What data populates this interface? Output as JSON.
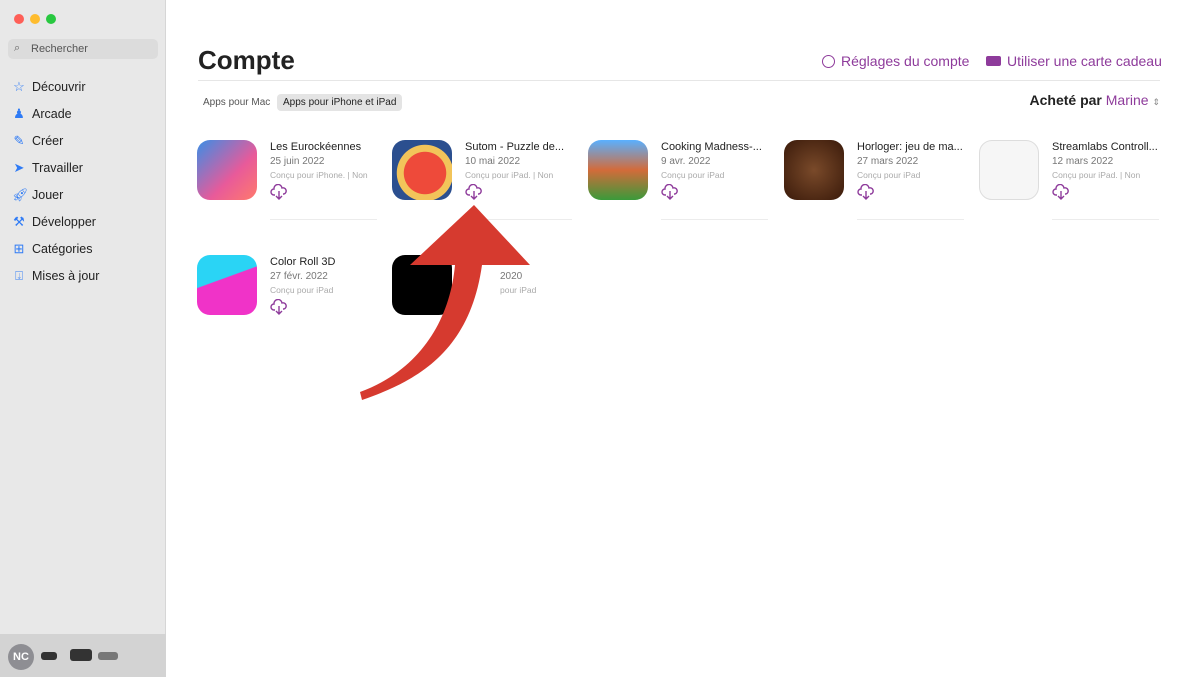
{
  "sidebar": {
    "search_placeholder": "Rechercher",
    "items": [
      {
        "label": "Découvrir",
        "icon": "star-icon"
      },
      {
        "label": "Arcade",
        "icon": "joystick-icon"
      },
      {
        "label": "Créer",
        "icon": "paintbrush-icon"
      },
      {
        "label": "Travailler",
        "icon": "paperplane-icon"
      },
      {
        "label": "Jouer",
        "icon": "rocket-icon"
      },
      {
        "label": "Développer",
        "icon": "hammer-icon"
      },
      {
        "label": "Catégories",
        "icon": "grid-icon"
      },
      {
        "label": "Mises à jour",
        "icon": "download-icon"
      }
    ],
    "user_initials": "NC"
  },
  "header": {
    "title": "Compte",
    "account_settings": "Réglages du compte",
    "gift_card": "Utiliser une carte cadeau"
  },
  "tabs": [
    {
      "label": "Apps pour Mac"
    },
    {
      "label": "Apps pour iPhone et iPad",
      "active": true
    }
  ],
  "buyer": {
    "label": "Acheté par",
    "name": "Marine"
  },
  "apps": [
    {
      "name": "Les Eurockéennes",
      "date": "25 juin 2022",
      "compat": "Conçu pour iPhone. | Non"
    },
    {
      "name": "Sutom - Puzzle de...",
      "date": "10 mai 2022",
      "compat": "Conçu pour iPad. | Non"
    },
    {
      "name": "Cooking Madness-...",
      "date": "9 avr. 2022",
      "compat": "Conçu pour iPad"
    },
    {
      "name": "Horloger: jeu de ma...",
      "date": "27 mars 2022",
      "compat": "Conçu pour iPad"
    },
    {
      "name": "Streamlabs Controll...",
      "date": "12 mars 2022",
      "compat": "Conçu pour iPad. | Non"
    },
    {
      "name": "Color Roll 3D",
      "date": "27 févr. 2022",
      "compat": "Conçu pour iPad"
    },
    {
      "name": "",
      "date": "2020",
      "compat": "pour iPad"
    }
  ],
  "colors": {
    "accent": "#8e3b9b",
    "sidebar_icon": "#2f7bf5",
    "arrow": "#d63a2f"
  }
}
